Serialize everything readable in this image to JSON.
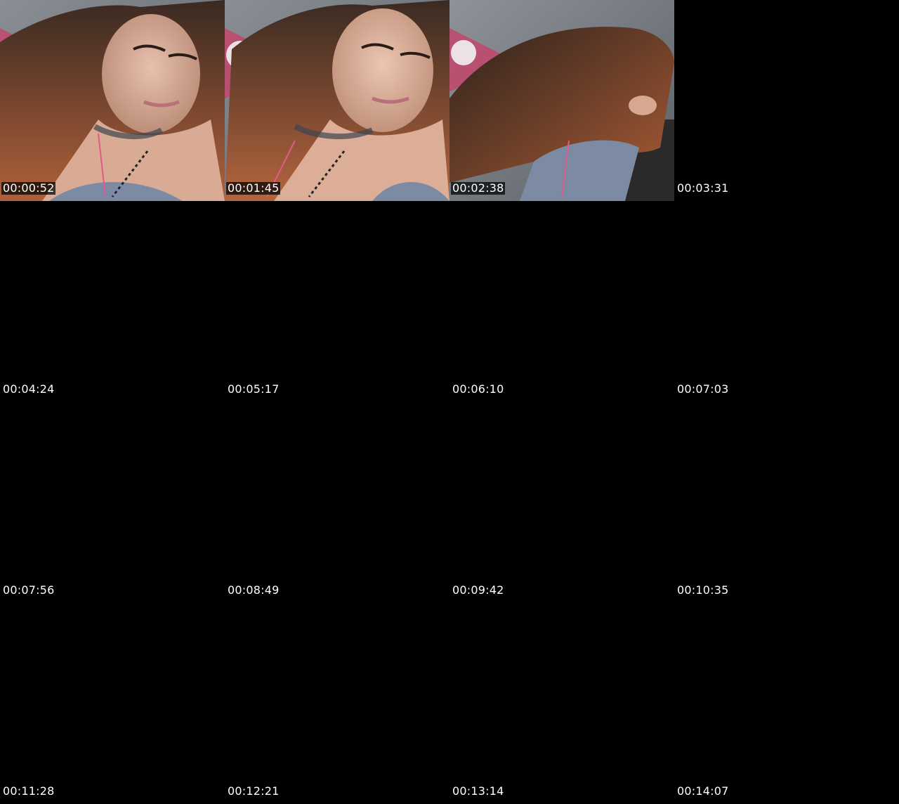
{
  "thumbnails": [
    {
      "timestamp": "00:00:52",
      "frame": "selfie-front-face",
      "has_image": true
    },
    {
      "timestamp": "00:01:45",
      "frame": "selfie-front-face-2",
      "has_image": true
    },
    {
      "timestamp": "00:02:38",
      "frame": "selfie-head-turned",
      "has_image": true
    },
    {
      "timestamp": "00:03:31",
      "frame": "black",
      "has_image": false
    },
    {
      "timestamp": "00:04:24",
      "frame": "black",
      "has_image": false
    },
    {
      "timestamp": "00:05:17",
      "frame": "black",
      "has_image": false
    },
    {
      "timestamp": "00:06:10",
      "frame": "black",
      "has_image": false
    },
    {
      "timestamp": "00:07:03",
      "frame": "black",
      "has_image": false
    },
    {
      "timestamp": "00:07:56",
      "frame": "black",
      "has_image": false
    },
    {
      "timestamp": "00:08:49",
      "frame": "black",
      "has_image": false
    },
    {
      "timestamp": "00:09:42",
      "frame": "black",
      "has_image": false
    },
    {
      "timestamp": "00:10:35",
      "frame": "black",
      "has_image": false
    },
    {
      "timestamp": "00:11:28",
      "frame": "black",
      "has_image": false
    },
    {
      "timestamp": "00:12:21",
      "frame": "black",
      "has_image": false
    },
    {
      "timestamp": "00:13:14",
      "frame": "black",
      "has_image": false
    },
    {
      "timestamp": "00:14:07",
      "frame": "black",
      "has_image": false
    }
  ],
  "colors": {
    "background": "#000000",
    "timestamp_text": "#ffffff"
  }
}
